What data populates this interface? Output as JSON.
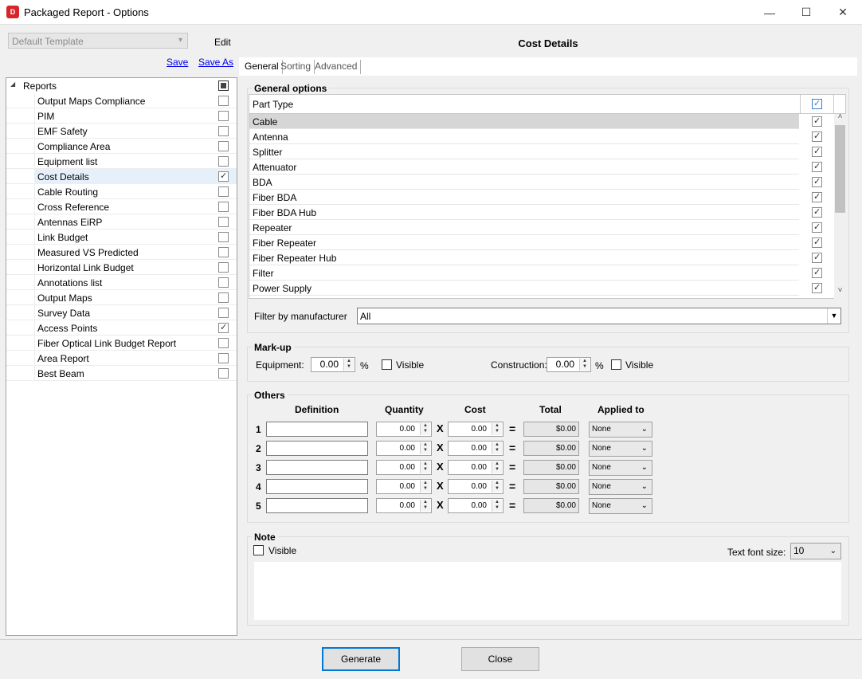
{
  "window": {
    "title": "Packaged Report - Options",
    "app_icon_text": "D",
    "minimize": "—",
    "maximize": "☐",
    "close": "✕"
  },
  "left": {
    "template_value": "Default Template",
    "edit_label": "Edit",
    "save_label": "Save",
    "save_as_label": "Save As",
    "tree_root": "Reports",
    "items": [
      {
        "label": "Output Maps Compliance",
        "checked": false
      },
      {
        "label": "PIM",
        "checked": false
      },
      {
        "label": "EMF Safety",
        "checked": false
      },
      {
        "label": "Compliance Area",
        "checked": false
      },
      {
        "label": "Equipment list",
        "checked": false
      },
      {
        "label": "Cost Details",
        "checked": true
      },
      {
        "label": "Cable Routing",
        "checked": false
      },
      {
        "label": "Cross Reference",
        "checked": false
      },
      {
        "label": "Antennas EiRP",
        "checked": false
      },
      {
        "label": "Link Budget",
        "checked": false
      },
      {
        "label": "Measured VS Predicted",
        "checked": false
      },
      {
        "label": "Horizontal Link Budget",
        "checked": false
      },
      {
        "label": "Annotations list",
        "checked": false
      },
      {
        "label": "Output Maps",
        "checked": false
      },
      {
        "label": "Survey Data",
        "checked": false
      },
      {
        "label": "Access Points",
        "checked": true
      },
      {
        "label": "Fiber Optical Link Budget Report",
        "checked": false
      },
      {
        "label": "Area Report",
        "checked": false
      },
      {
        "label": "Best Beam",
        "checked": false
      }
    ]
  },
  "right": {
    "heading": "Cost Details",
    "tabs": [
      "General",
      "Sorting",
      "Advanced"
    ],
    "general_options": {
      "title": "General options",
      "column_header": "Part Type",
      "rows": [
        "Cable",
        "Antenna",
        "Splitter",
        "Attenuator",
        "BDA",
        "Fiber BDA",
        "Fiber BDA Hub",
        "Repeater",
        "Fiber Repeater",
        "Fiber Repeater Hub",
        "Filter",
        "Power Supply"
      ],
      "filter_label": "Filter by manufacturer",
      "filter_value": "All"
    },
    "markup": {
      "title": "Mark-up",
      "equipment_label": "Equipment:",
      "equipment_value": "0.00",
      "construction_label": "Construction:",
      "construction_value": "0.00",
      "percent": "%",
      "visible_label": "Visible"
    },
    "others": {
      "title": "Others",
      "headers": {
        "definition": "Definition",
        "quantity": "Quantity",
        "cost": "Cost",
        "total": "Total",
        "applied": "Applied to"
      },
      "times": "X",
      "equals": "=",
      "rows": [
        {
          "num": "1",
          "quantity": "0.00",
          "cost": "0.00",
          "total": "$0.00",
          "applied": "None"
        },
        {
          "num": "2",
          "quantity": "0.00",
          "cost": "0.00",
          "total": "$0.00",
          "applied": "None"
        },
        {
          "num": "3",
          "quantity": "0.00",
          "cost": "0.00",
          "total": "$0.00",
          "applied": "None"
        },
        {
          "num": "4",
          "quantity": "0.00",
          "cost": "0.00",
          "total": "$0.00",
          "applied": "None"
        },
        {
          "num": "5",
          "quantity": "0.00",
          "cost": "0.00",
          "total": "$0.00",
          "applied": "None"
        }
      ]
    },
    "note": {
      "title": "Note",
      "visible_label": "Visible",
      "font_size_label": "Text font size:",
      "font_size_value": "10"
    }
  },
  "footer": {
    "generate_label": "Generate",
    "close_label": "Close"
  }
}
